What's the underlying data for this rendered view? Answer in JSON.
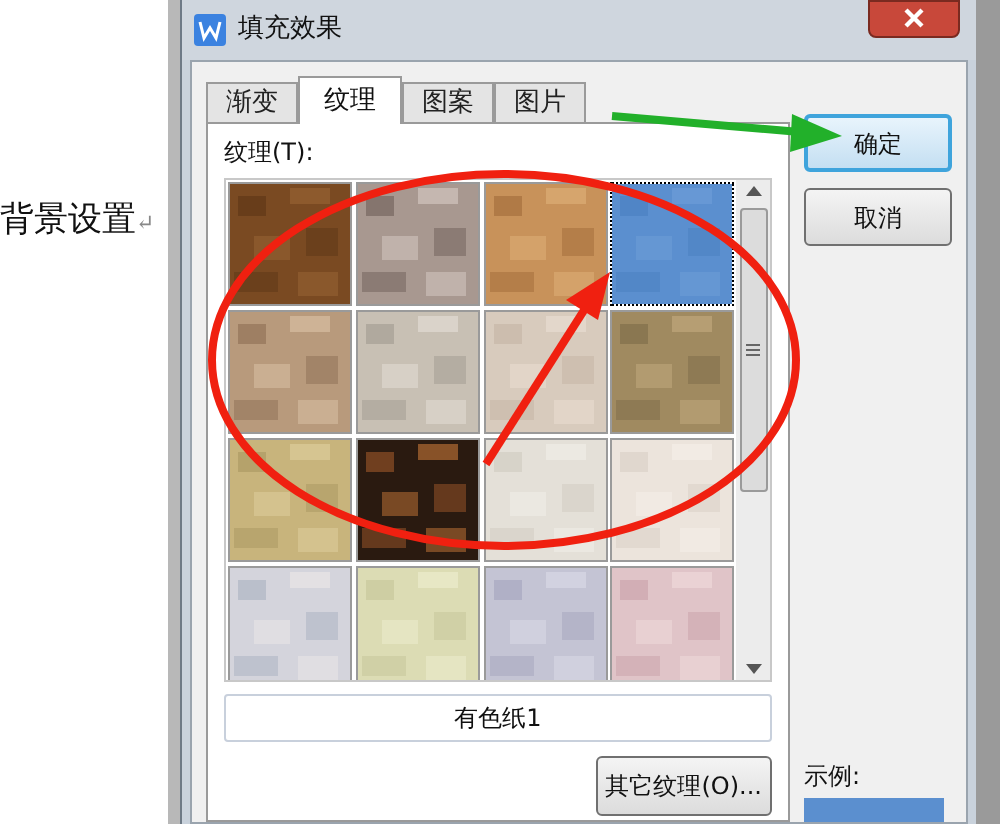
{
  "document": {
    "text": "背景设置",
    "mark": "↵"
  },
  "window": {
    "title": "填充效果"
  },
  "tabs": [
    {
      "label": "渐变",
      "selected": false
    },
    {
      "label": "纹理",
      "selected": true
    },
    {
      "label": "图案",
      "selected": false
    },
    {
      "label": "图片",
      "selected": false
    }
  ],
  "texture_label": "纹理(T):",
  "textures": [
    {
      "kind": "picture",
      "selected": false
    },
    {
      "kind": "picture",
      "selected": false
    },
    {
      "kind": "picture",
      "selected": false
    },
    {
      "kind": "picture",
      "selected": true
    },
    {
      "kind": "picture",
      "selected": false
    },
    {
      "kind": "picture",
      "selected": false
    },
    {
      "kind": "picture",
      "selected": false
    },
    {
      "kind": "picture",
      "selected": false
    },
    {
      "kind": "picture",
      "selected": false
    },
    {
      "kind": "picture",
      "selected": false
    },
    {
      "kind": "picture",
      "selected": false
    },
    {
      "kind": "picture",
      "selected": false
    },
    {
      "kind": "picture",
      "selected": false
    },
    {
      "kind": "picture",
      "selected": false
    },
    {
      "kind": "picture",
      "selected": false
    },
    {
      "kind": "picture",
      "selected": false
    }
  ],
  "texture_name": "有色纸1",
  "other_textures_button": "其它纹理(O)...",
  "buttons": [
    "确定",
    "取消"
  ],
  "sample_label": "示例:"
}
